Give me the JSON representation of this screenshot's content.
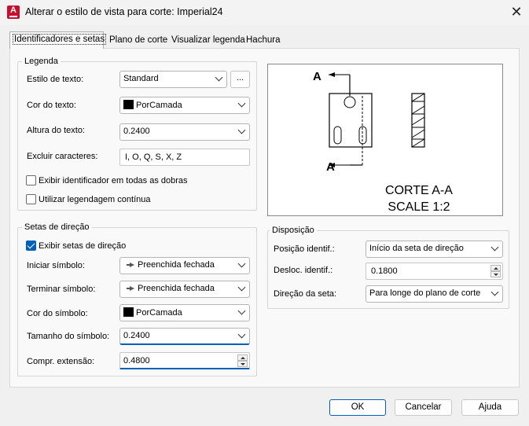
{
  "window": {
    "title": "Alterar o estilo de vista para corte: Imperial24",
    "app_icon_letter": "A"
  },
  "tabs": [
    {
      "label": "Identificadores e setas"
    },
    {
      "label": "Plano de corte"
    },
    {
      "label": "Visualizar legenda"
    },
    {
      "label": "Hachura"
    }
  ],
  "legenda": {
    "group_label": "Legenda",
    "text_style_label": "Estilo de texto:",
    "text_style_value": "Standard",
    "browse_label": "...",
    "text_color_label": "Cor do texto:",
    "text_color_value": "PorCamada",
    "text_height_label": "Altura do texto:",
    "text_height_value": "0.2400",
    "exclude_label": "Excluir caracteres:",
    "exclude_value": "I, O, Q, S, X, Z",
    "show_all_bends_label": "Exibir identificador em todas as dobras",
    "show_all_bends_checked": false,
    "continuous_label": "Utilizar legendagem contínua",
    "continuous_checked": false
  },
  "setas": {
    "group_label": "Setas de direção",
    "show_arrows_label": "Exibir setas de direção",
    "show_arrows_checked": true,
    "start_symbol_label": "Iniciar símbolo:",
    "start_symbol_value": "Preenchida fechada",
    "end_symbol_label": "Terminar símbolo:",
    "end_symbol_value": "Preenchida fechada",
    "symbol_color_label": "Cor do símbolo:",
    "symbol_color_value": "PorCamada",
    "symbol_size_label": "Tamanho do símbolo:",
    "symbol_size_value": "0.2400",
    "extension_label": "Compr. extensão:",
    "extension_value": "0.4800"
  },
  "preview": {
    "label_top": "A",
    "label_bottom": "A",
    "caption_line1": "CORTE A-A",
    "caption_line2": "SCALE 1:2"
  },
  "disposicao": {
    "group_label": "Disposição",
    "id_position_label": "Posição identif.:",
    "id_position_value": "Início da seta de direção",
    "id_offset_label": "Desloc. identif.:",
    "id_offset_value": "0.1800",
    "arrow_direction_label": "Direção da seta:",
    "arrow_direction_value": "Para longe do plano de corte"
  },
  "footer": {
    "ok_label": "OK",
    "cancel_label": "Cancelar",
    "help_label": "Ajuda"
  },
  "colors": {
    "accent": "#005fb8",
    "brand_red": "#c8102e"
  }
}
